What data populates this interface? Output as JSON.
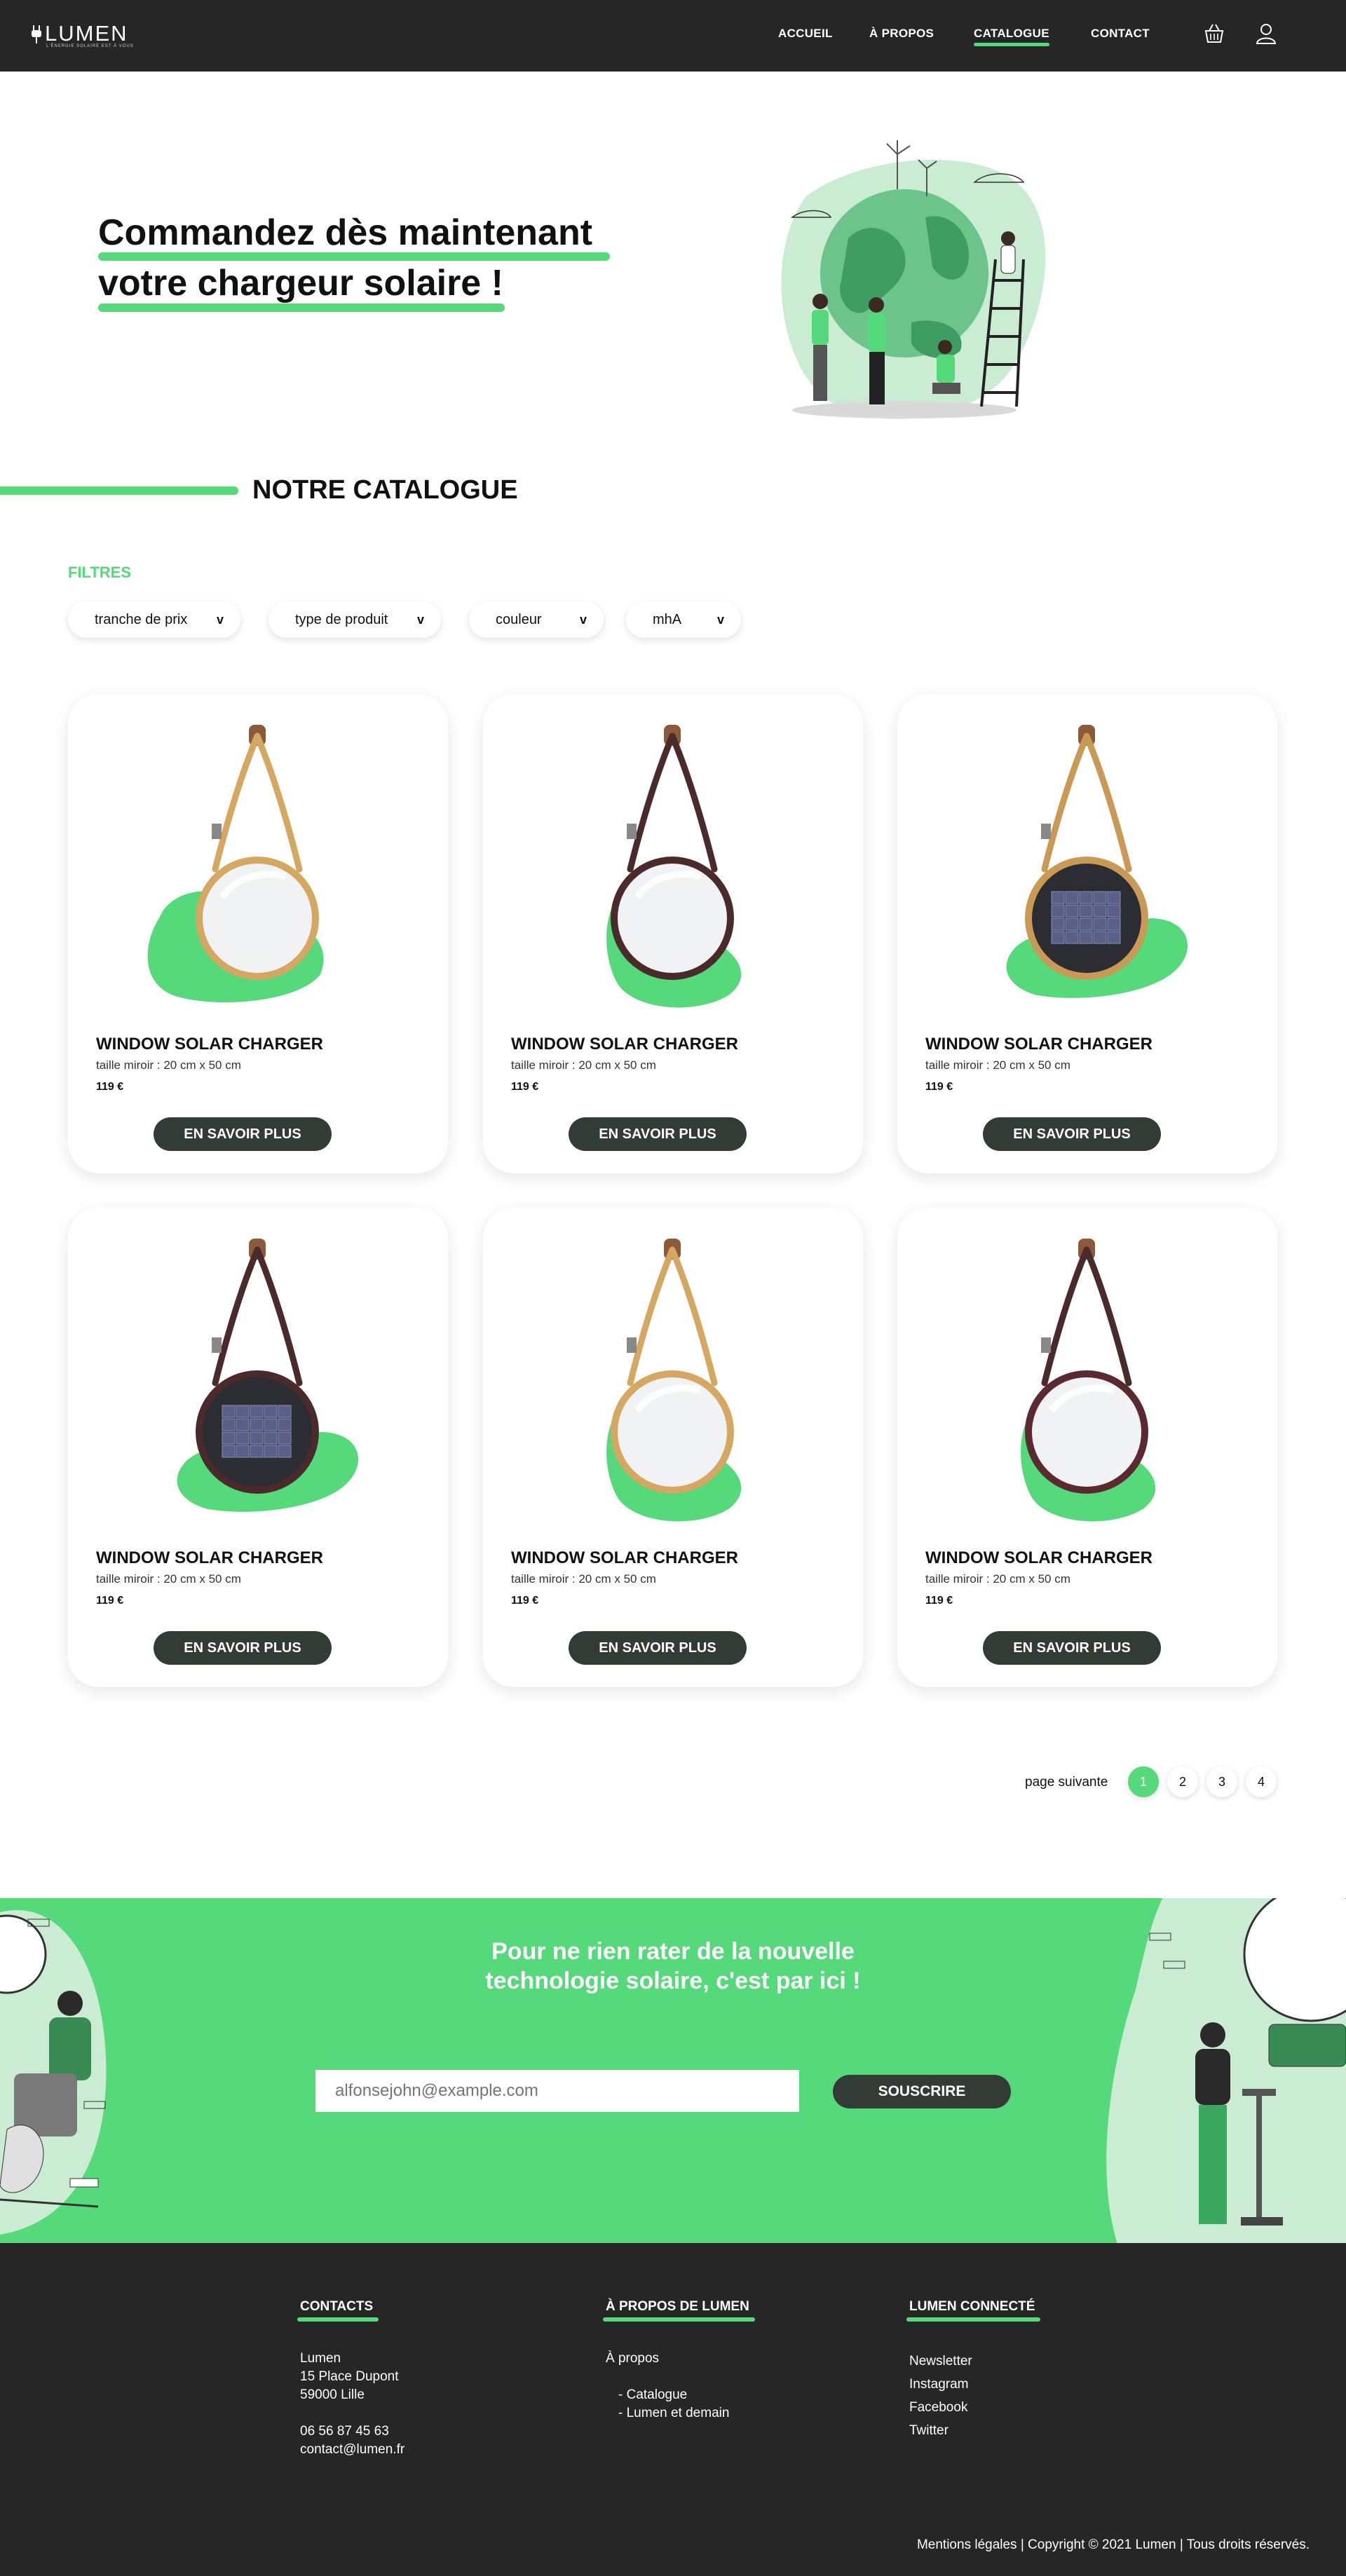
{
  "nav": {
    "logo_text": "LUMEN",
    "logo_tagline": "L'ÉNERGIE SOLAIRE EST À VOUS",
    "links": [
      "ACCUEIL",
      "À PROPOS",
      "CATALOGUE",
      "CONTACT"
    ],
    "active": "CATALOGUE",
    "icons": [
      "basket-icon",
      "user-icon"
    ]
  },
  "hero": {
    "line1": "Commandez dès maintenant",
    "line2": "votre chargeur solaire !"
  },
  "catalogue": {
    "title": "NOTRE CATALOGUE",
    "filters_label": "FILTRES",
    "filters": [
      {
        "label": "tranche de prix",
        "chevron": "v"
      },
      {
        "label": "type de produit",
        "chevron": "v"
      },
      {
        "label": "couleur",
        "chevron": "v"
      },
      {
        "label": "mhA",
        "chevron": "v"
      }
    ],
    "products": [
      {
        "title": "WINDOW SOLAR CHARGER",
        "desc": "taille miroir : 20 cm x 50 cm",
        "price": "119 €",
        "button": "EN SAVOIR PLUS",
        "strap": "#d4a862",
        "frame": "#d4a862",
        "panel": false
      },
      {
        "title": "WINDOW SOLAR CHARGER",
        "desc": "taille miroir : 20 cm x 50 cm",
        "price": "119 €",
        "button": "EN SAVOIR PLUS",
        "strap": "#4a2a2a",
        "frame": "#4a2a2a",
        "panel": false
      },
      {
        "title": "WINDOW SOLAR CHARGER",
        "desc": "taille miroir : 20 cm x 50 cm",
        "price": "119 €",
        "button": "EN SAVOIR PLUS",
        "strap": "#c99a55",
        "frame": "#c99a55",
        "panel": true
      },
      {
        "title": "WINDOW SOLAR CHARGER",
        "desc": "taille miroir : 20 cm x 50 cm",
        "price": "119 €",
        "button": "EN SAVOIR PLUS",
        "strap": "#4a2a2a",
        "frame": "#4a2a2a",
        "panel": true
      },
      {
        "title": "WINDOW SOLAR CHARGER",
        "desc": "taille miroir : 20 cm x 50 cm",
        "price": "119 €",
        "button": "EN SAVOIR PLUS",
        "strap": "#d4a862",
        "frame": "#d4a862",
        "panel": false
      },
      {
        "title": "WINDOW SOLAR CHARGER",
        "desc": "taille miroir : 20 cm x 50 cm",
        "price": "119 €",
        "button": "EN SAVOIR PLUS",
        "strap": "#4a2a2a",
        "frame": "#5a2a30",
        "panel": false
      }
    ]
  },
  "pagination": {
    "label": "page suivante",
    "pages": [
      "1",
      "2",
      "3",
      "4"
    ],
    "active": "1"
  },
  "newsletter": {
    "title_line1": "Pour ne rien rater de la nouvelle",
    "title_line2": "technologie solaire, c'est par ici !",
    "placeholder": "alfonsejohn@example.com",
    "button": "SOUSCRIRE"
  },
  "footer": {
    "contacts": {
      "heading": "CONTACTS",
      "lines": [
        "Lumen",
        "15 Place Dupont",
        "59000 Lille"
      ],
      "phone": "06 56 87 45 63",
      "email": "contact@lumen.fr"
    },
    "about": {
      "heading": "À PROPOS DE LUMEN",
      "link": "À propos",
      "sublinks": [
        "- Catalogue",
        "- Lumen et demain"
      ]
    },
    "connected": {
      "heading": "LUMEN CONNECTÉ",
      "links": [
        "Newsletter",
        "Instagram",
        "Facebook",
        "Twitter"
      ]
    },
    "copyright": "Mentions légales | Copyright © 2021 Lumen | Tous droits réservés."
  },
  "colors": {
    "accent": "#55d97a",
    "dark": "#262626",
    "button": "#333b37"
  }
}
